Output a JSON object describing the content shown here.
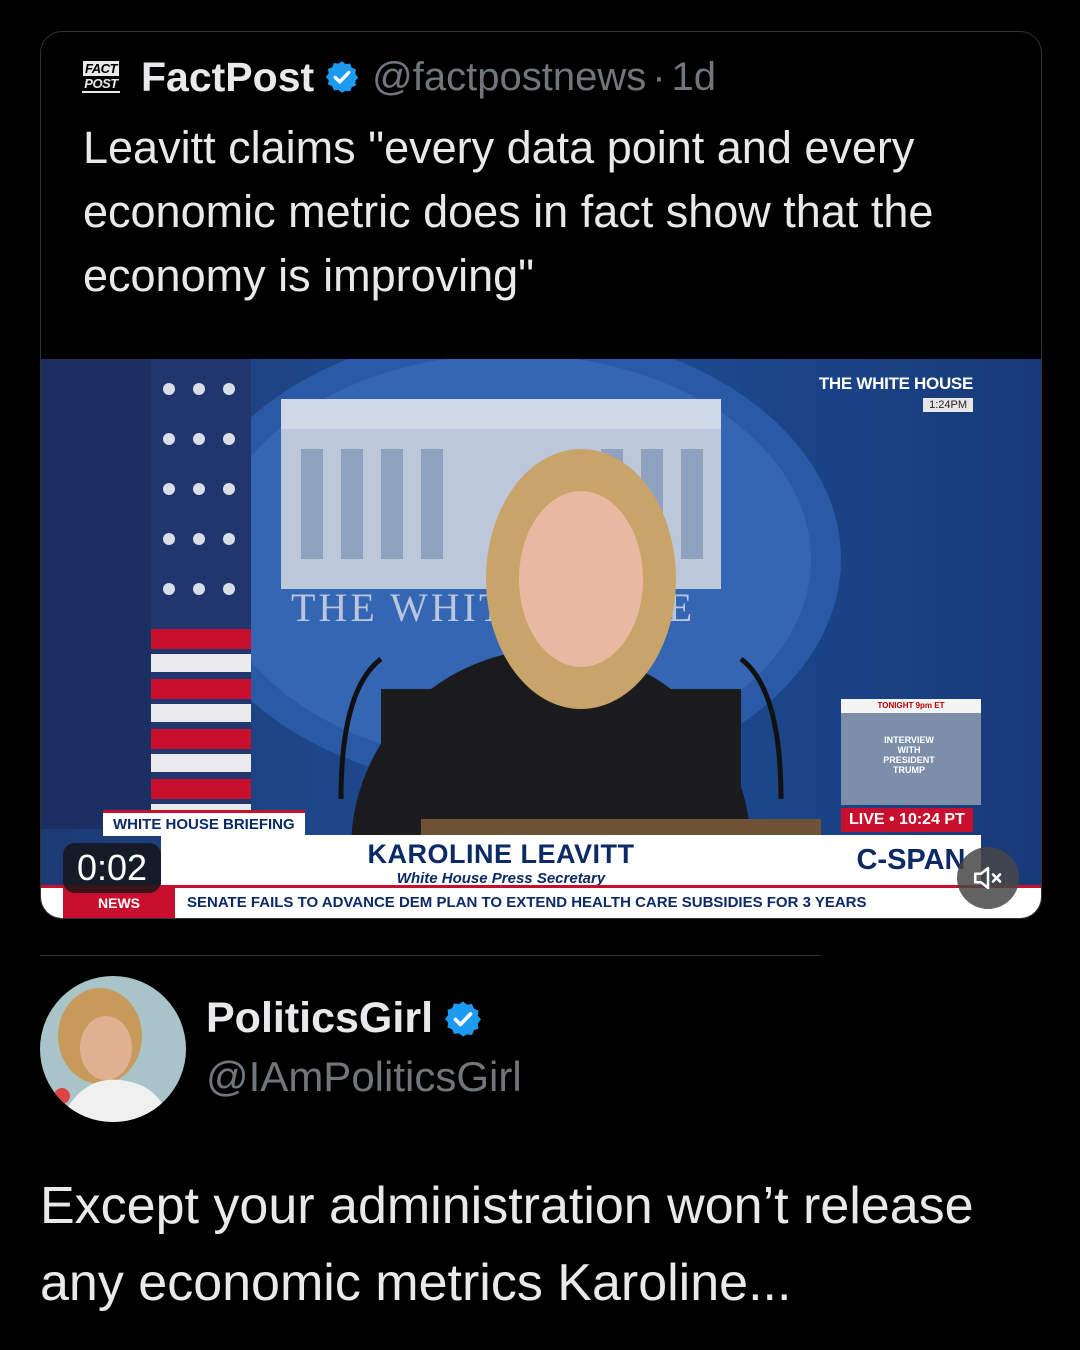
{
  "quoted_post": {
    "logo_line1": "FACT",
    "logo_line2": "POST",
    "author_name": "FactPost",
    "handle": "@factpostnews",
    "separator": "·",
    "time": "1d",
    "text": "Leavitt claims \"every data point and every economic metric does in fact show that the economy is improving\"",
    "video": {
      "timestamp": "0:02",
      "corner_title": "THE WHITE HOUSE",
      "corner_time": "1:24PM",
      "backdrop_text": "THE WHITE HOUSE",
      "promo_top": "TONIGHT 9pm ET",
      "promo_text": "INTERVIEW WITH PRESIDENT TRUMP",
      "briefing_label": "WHITE HOUSE BRIEFING",
      "live_label": "LIVE • 10:24 PT",
      "speaker_name": "KAROLINE LEAVITT",
      "speaker_title": "White House Press Secretary",
      "network": "C-SPAN",
      "ticker_label": "NEWS",
      "ticker_text": "SENATE FAILS TO ADVANCE DEM PLAN TO EXTEND HEALTH CARE SUBSIDIES FOR 3 YEARS"
    }
  },
  "reply": {
    "author_name": "PoliticsGirl",
    "handle": "@IAmPoliticsGirl",
    "text": "Except your administration won’t release any economic metrics Karoline..."
  },
  "colors": {
    "background": "#000000",
    "primary_text": "#e7e9ea",
    "secondary_text": "#71767b",
    "verified_blue": "#1d9bf0",
    "cspan_navy": "#0b2a66",
    "news_red": "#c8102e"
  },
  "icons": [
    "verified-badge-icon",
    "mute-icon"
  ]
}
